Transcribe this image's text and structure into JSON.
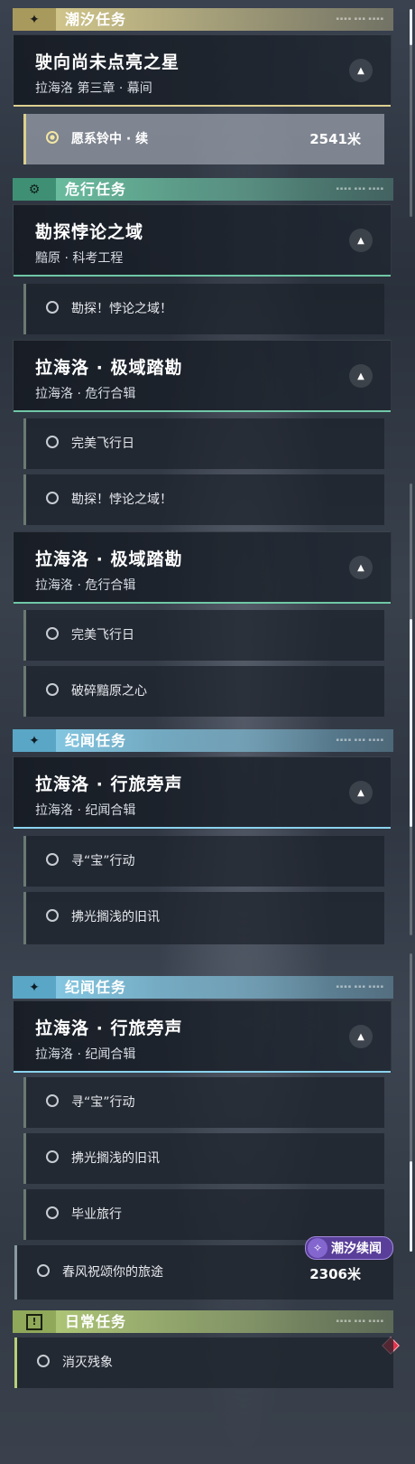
{
  "tide": {
    "header": "潮汐任务",
    "card": {
      "title": "驶向尚未点亮之星",
      "subtitle": "拉海洛 第三章 · 幕间"
    },
    "active_item": {
      "label": "愿系铃中 · 续",
      "distance": "2541米"
    }
  },
  "danger": {
    "header": "危行任务",
    "card1": {
      "title": "勘探悖论之域",
      "subtitle": "黯原 · 科考工程"
    },
    "item1": "勘探！悖论之域！",
    "card2": {
      "title": "拉海洛 · 极域踏勘",
      "subtitle": "拉海洛 · 危行合辑"
    },
    "item2": "完美飞行日"
  },
  "danger2": {
    "item1": "勘探！悖论之域！",
    "card": {
      "title": "拉海洛 · 极域踏勘",
      "subtitle": "拉海洛 · 危行合辑"
    },
    "item2": "完美飞行日",
    "item3": "破碎黯原之心"
  },
  "chronicle": {
    "header": "纪闻任务",
    "card": {
      "title": "拉海洛 · 行旅旁声",
      "subtitle": "拉海洛 · 纪闻合辑"
    },
    "item1": "寻“宝”行动",
    "item2": "拂光搁浅的旧讯"
  },
  "chronicle2": {
    "header": "纪闻任务",
    "card": {
      "title": "拉海洛 · 行旅旁声",
      "subtitle": "拉海洛 · 纪闻合辑"
    },
    "item1": "寻“宝”行动",
    "item2": "拂光搁浅的旧讯",
    "item3": "毕业旅行",
    "item4": "春风祝颂你的旅途",
    "item4_distance": "2306米",
    "badge": "潮汐续闻"
  },
  "daily": {
    "header": "日常任务",
    "item1": "消灭残象"
  },
  "colors": {
    "tide": "#dccf8f",
    "danger": "#6fc7a6",
    "chronicle": "#8ad2ee",
    "daily": "#b7d07a",
    "badge": "#5a3f9a"
  },
  "scroll": {
    "seg1": 0.15,
    "seg2": 0.55,
    "seg3": 0.85
  }
}
